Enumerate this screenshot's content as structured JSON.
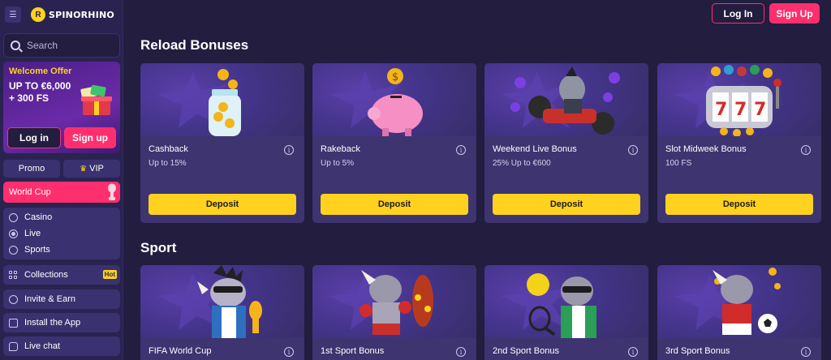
{
  "brand": {
    "name": "SPINORHINO"
  },
  "search": {
    "placeholder": "Search"
  },
  "offer": {
    "title": "Welcome Offer",
    "line1": "UP TO €6,000",
    "line2": "+ 300 FS",
    "login": "Log in",
    "signup": "Sign up"
  },
  "promo": {
    "promo": "Promo",
    "vip": "VIP"
  },
  "worldcup": {
    "label": "World Cup"
  },
  "nav": {
    "casino": "Casino",
    "live": "Live",
    "sports": "Sports",
    "collections": "Collections",
    "hot": "Hot",
    "invite": "Invite & Earn",
    "install": "Install the App",
    "chat": "Live chat"
  },
  "header": {
    "login": "Log In",
    "signup": "Sign Up"
  },
  "reload": {
    "title": "Reload Bonuses",
    "cards": [
      {
        "title": "Cashback",
        "sub": "Up to 15%",
        "button": "Deposit"
      },
      {
        "title": "Rakeback",
        "sub": "Up to 5%",
        "button": "Deposit"
      },
      {
        "title": "Weekend Live Bonus",
        "sub": "25% Up to €600",
        "button": "Deposit"
      },
      {
        "title": "Slot Midweek Bonus",
        "sub": "100 FS",
        "button": "Deposit"
      }
    ]
  },
  "sport": {
    "title": "Sport",
    "cards": [
      {
        "title": "FIFA World Cup"
      },
      {
        "title": "1st Sport Bonus"
      },
      {
        "title": "2nd Sport Bonus"
      },
      {
        "title": "3rd Sport Bonus"
      }
    ]
  },
  "colors": {
    "background": "#231d3f",
    "sidebar": "#2a2350",
    "accent_pink": "#ff2f6e",
    "accent_yellow": "#ffd21f",
    "card": "#3d3470"
  }
}
